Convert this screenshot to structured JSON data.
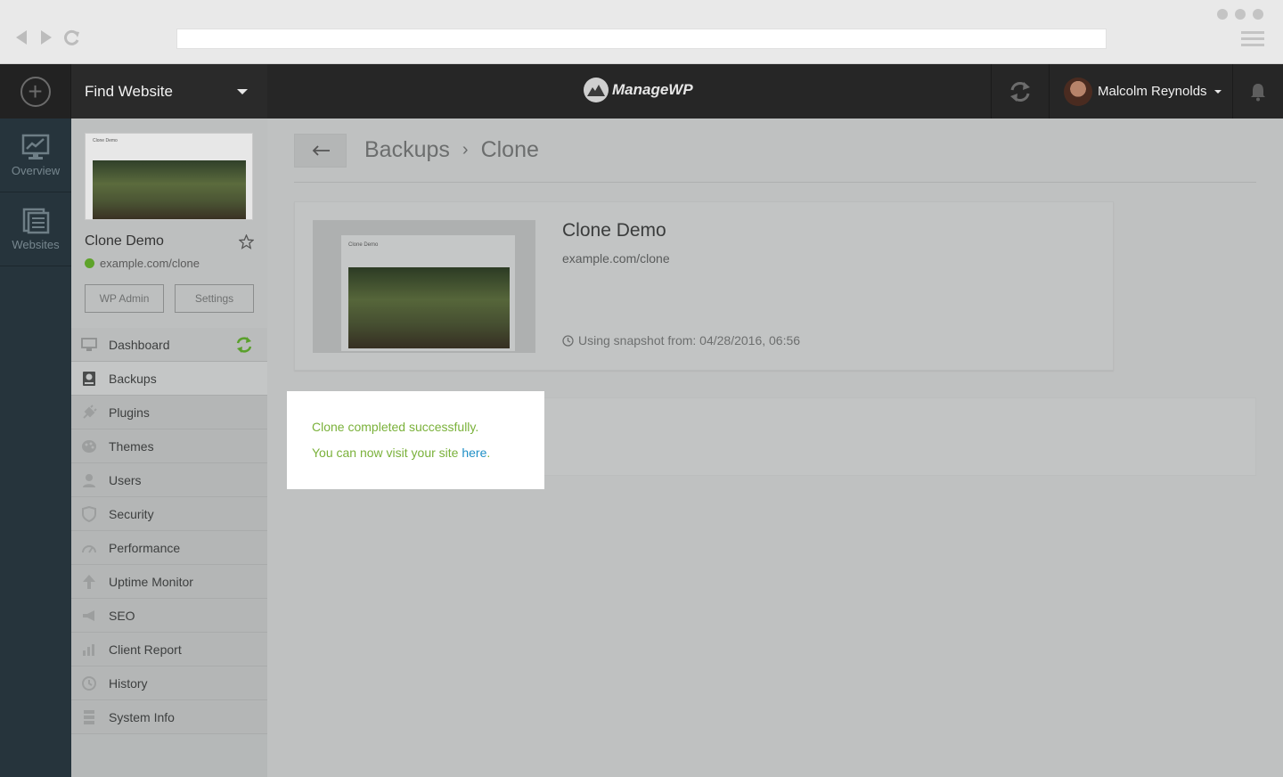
{
  "topbar": {
    "find_website_label": "Find Website",
    "logo_text": "ManageWP",
    "user_name": "Malcolm Reynolds"
  },
  "rail": {
    "items": [
      {
        "label": "Overview",
        "icon": "chart-monitor-icon"
      },
      {
        "label": "Websites",
        "icon": "pages-icon"
      }
    ]
  },
  "site": {
    "name": "Clone Demo",
    "url": "example.com/clone",
    "wp_admin_label": "WP Admin",
    "settings_label": "Settings",
    "thumb_title": "Clone Demo"
  },
  "menu": [
    {
      "label": "Dashboard",
      "icon": "monitor-icon"
    },
    {
      "label": "Backups",
      "icon": "backup-drive-icon"
    },
    {
      "label": "Plugins",
      "icon": "plug-icon"
    },
    {
      "label": "Themes",
      "icon": "palette-icon"
    },
    {
      "label": "Users",
      "icon": "user-icon"
    },
    {
      "label": "Security",
      "icon": "shield-icon"
    },
    {
      "label": "Performance",
      "icon": "speedometer-icon"
    },
    {
      "label": "Uptime Monitor",
      "icon": "arrow-up-icon"
    },
    {
      "label": "SEO",
      "icon": "megaphone-icon"
    },
    {
      "label": "Client Report",
      "icon": "report-chart-icon"
    },
    {
      "label": "History",
      "icon": "clock-icon"
    },
    {
      "label": "System Info",
      "icon": "server-icon"
    }
  ],
  "main": {
    "breadcrumb": {
      "parent": "Backups",
      "separator": "›",
      "current": "Clone"
    },
    "detail": {
      "title": "Clone Demo",
      "url": "example.com/clone",
      "snapshot_text": "Using snapshot from: 04/28/2016, 06:56"
    },
    "success": {
      "line1": "Clone completed successfully.",
      "line2_prefix": "You can now visit your site ",
      "link_text": "here",
      "line2_suffix": "."
    }
  },
  "colors": {
    "accent_green": "#7ab13a",
    "link_blue": "#1f8fc6",
    "rail_bg": "#26343c",
    "topbar_bg": "#262626"
  }
}
